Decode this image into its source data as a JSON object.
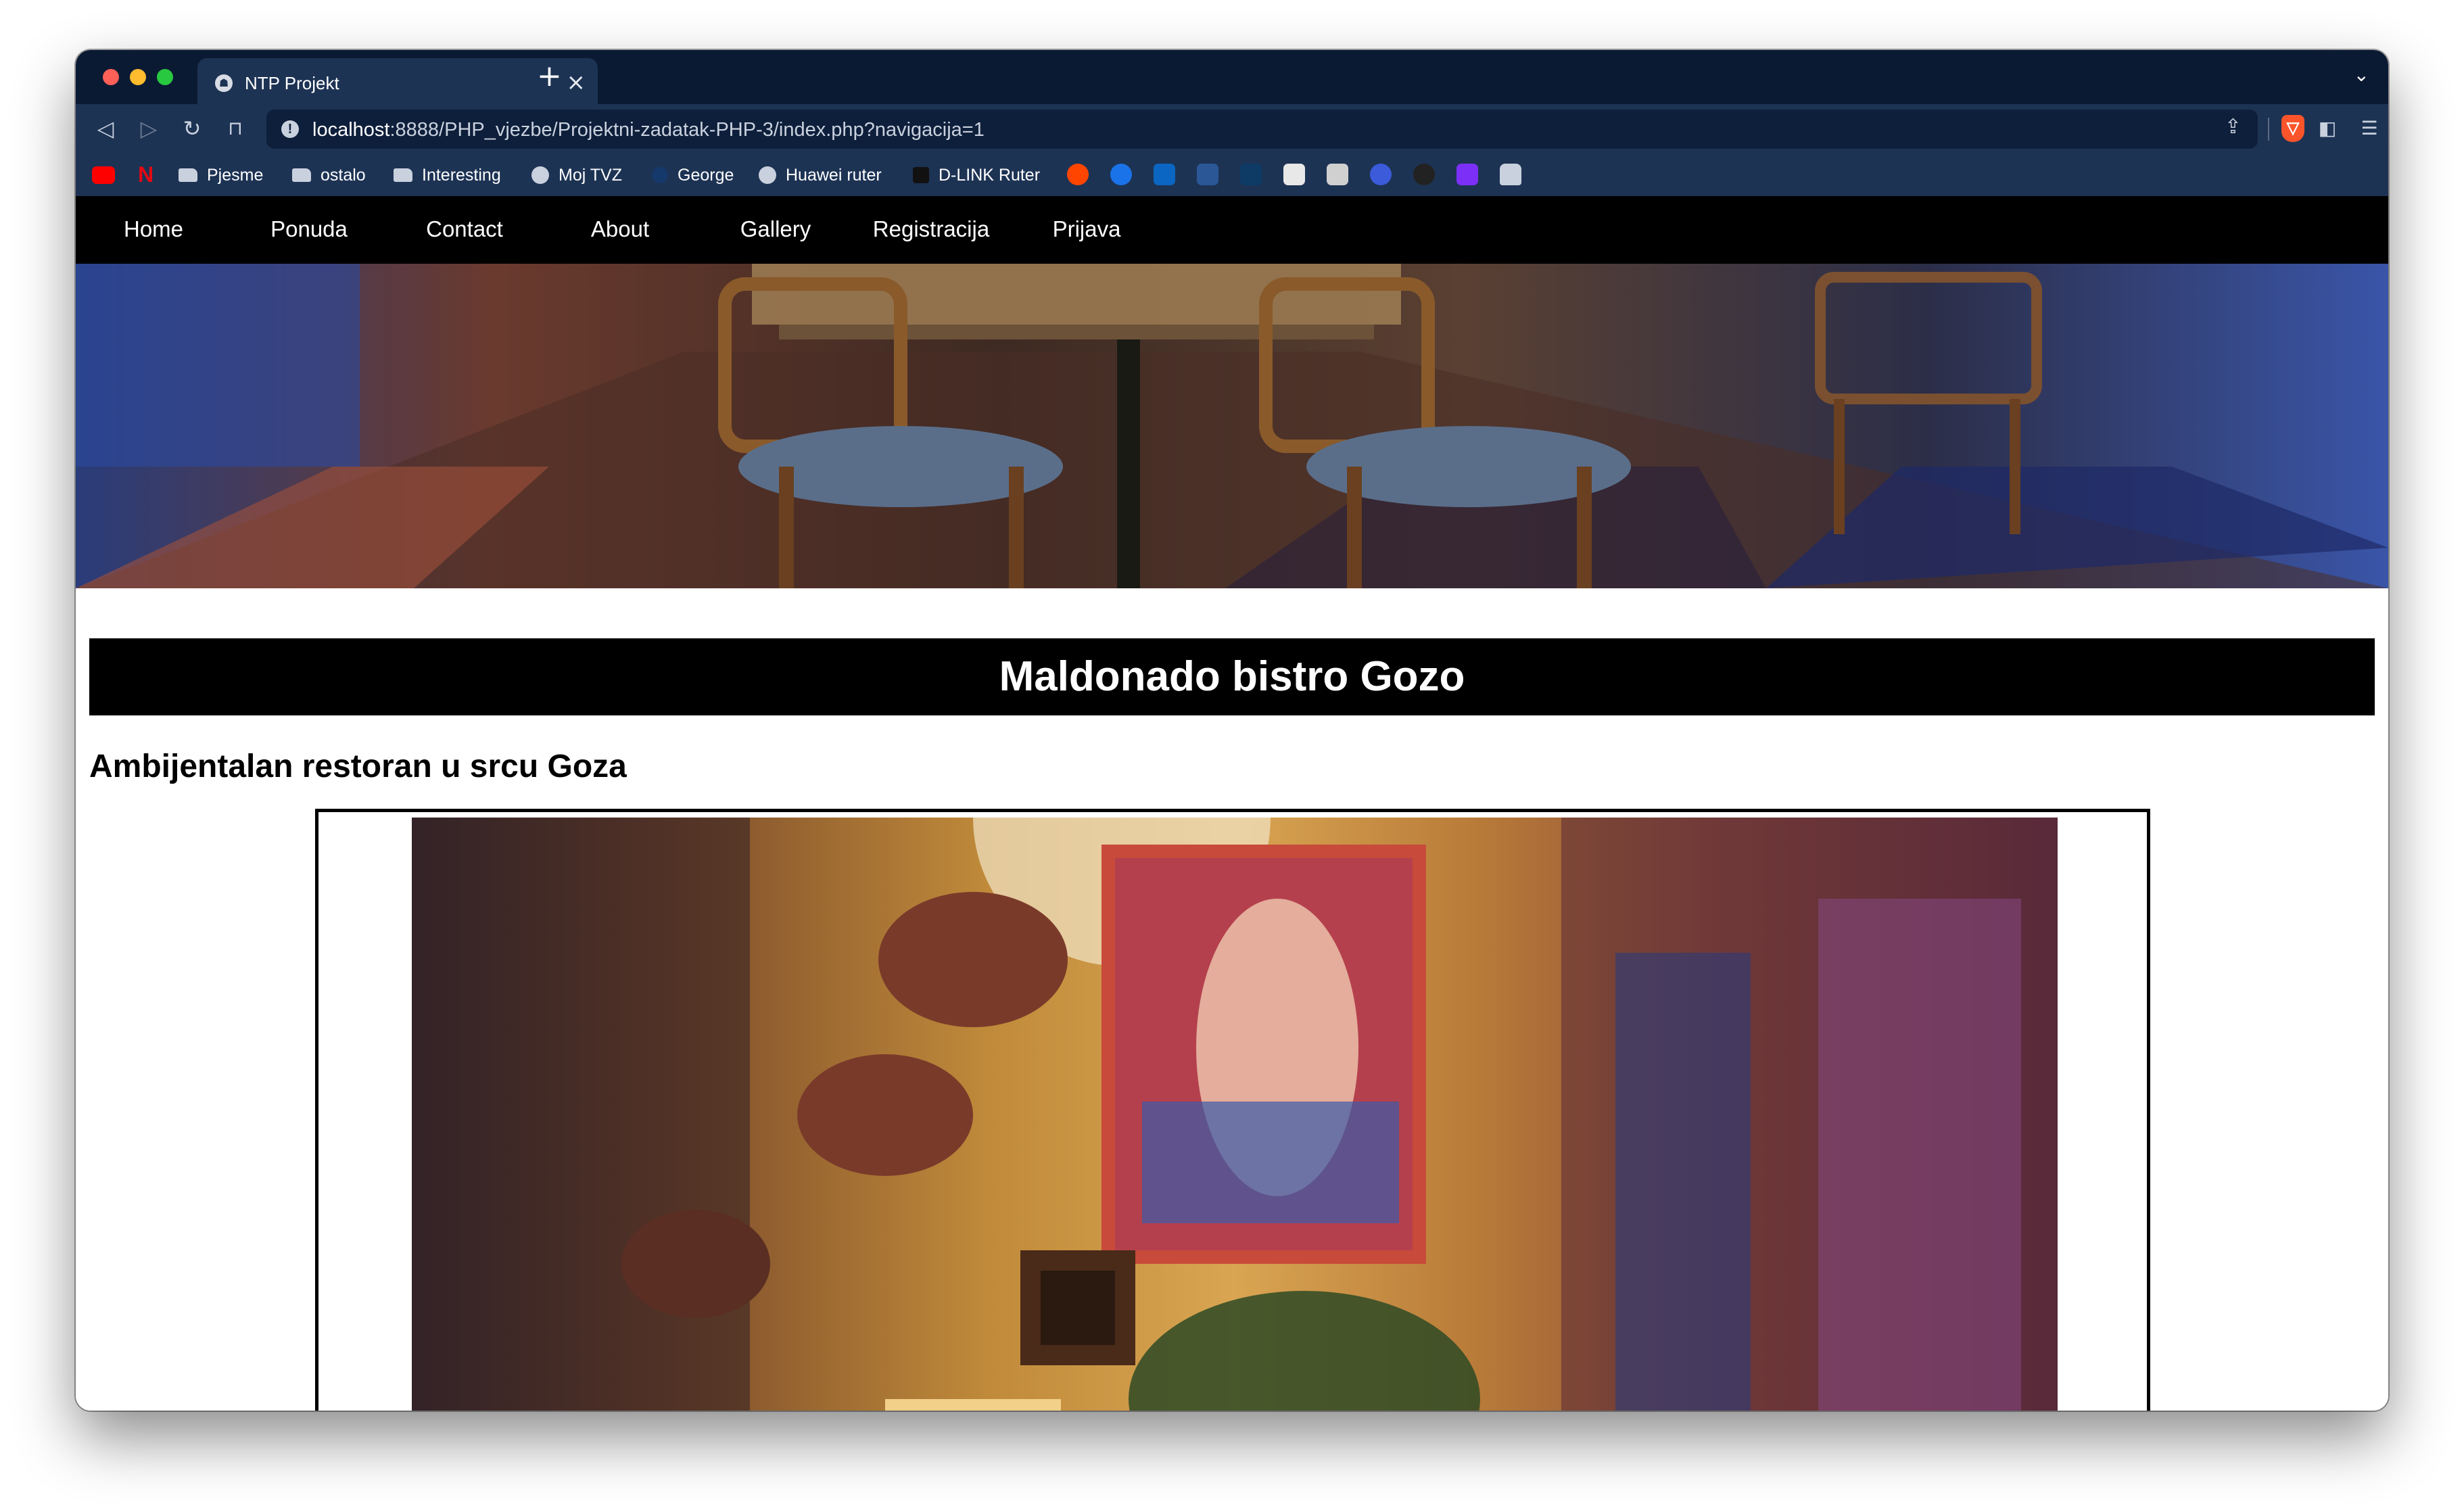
{
  "browser": {
    "tab_title": "NTP Projekt",
    "tab_close": "×",
    "new_tab": "+",
    "tab_list": "⌄",
    "url_host": "localhost",
    "url_rest": ":8888/PHP_vjezbe/Projektni-zadatak-PHP-3/index.php?navigacija=1",
    "bookmarks": [
      "Pjesme",
      "ostalo",
      "Interesting",
      "Moj TVZ",
      "George",
      "Huawei ruter",
      "D-LINK Ruter"
    ]
  },
  "nav": {
    "items": [
      "Home",
      "Ponuda",
      "Contact",
      "About",
      "Gallery",
      "Registracija",
      "Prijava"
    ]
  },
  "main": {
    "title": "Maldonado bistro Gozo",
    "subtitle": "Ambijentalan restoran u srcu Goza"
  },
  "colors": {
    "chrome_dark": "#0b1a33",
    "chrome": "#1d3354",
    "nav_bg": "#000000",
    "nav_text": "#ffffff"
  }
}
